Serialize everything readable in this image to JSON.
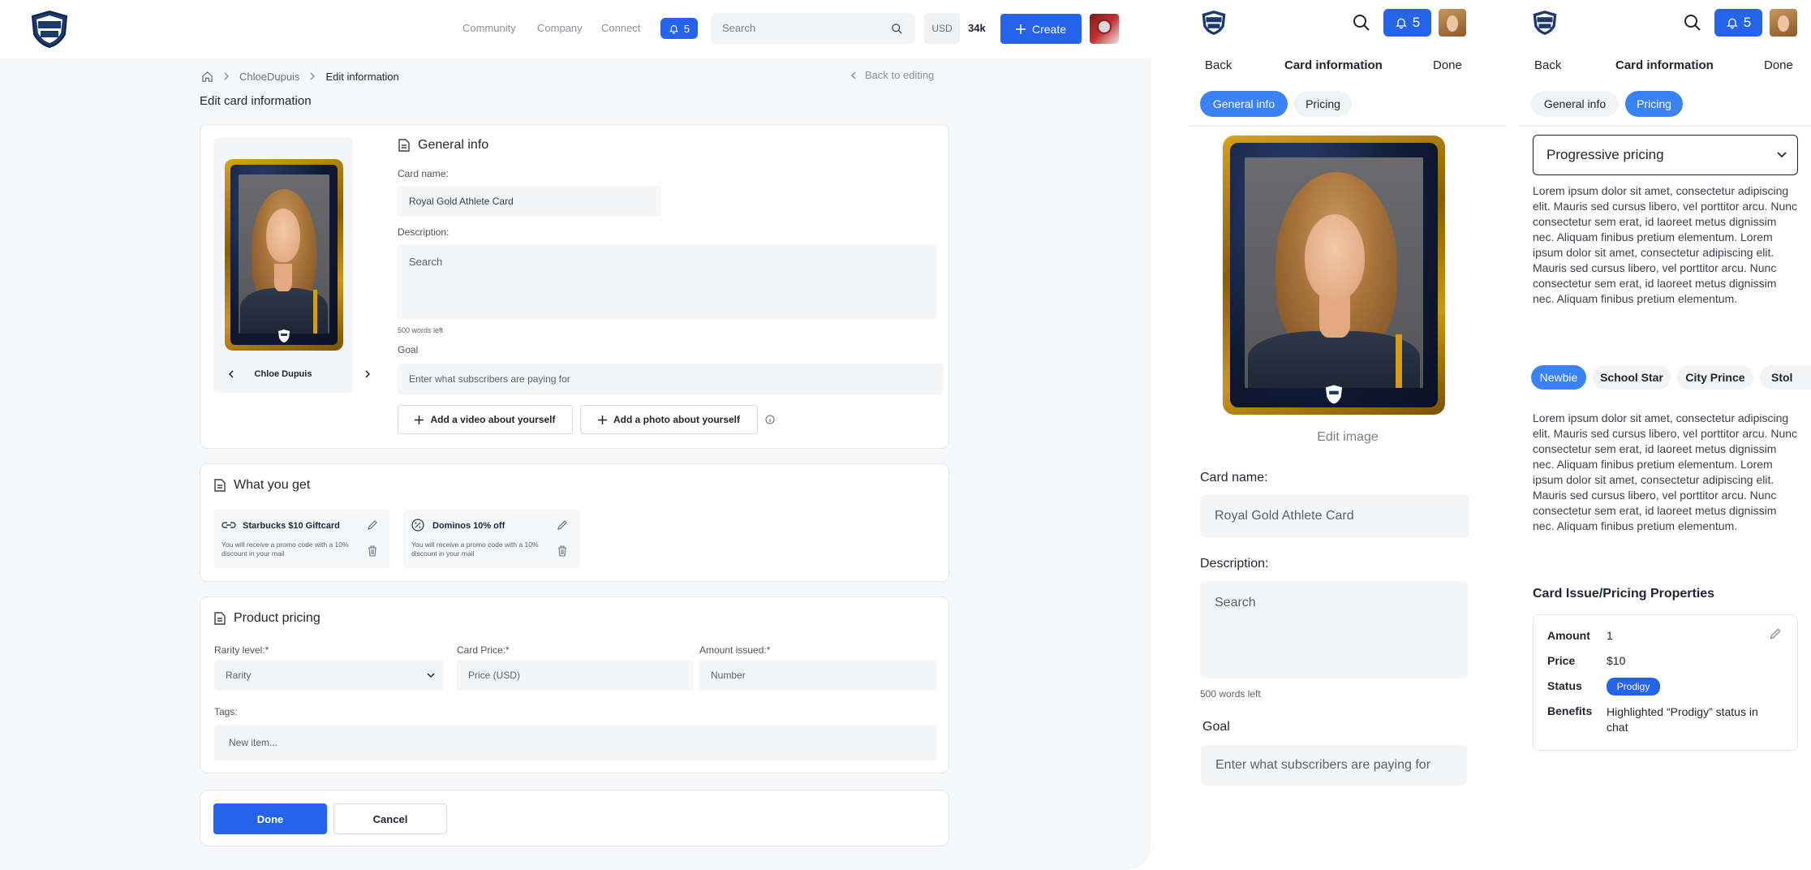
{
  "desktop": {
    "nav": {
      "links": [
        "Community",
        "Company",
        "Connect"
      ],
      "notif_count": "5",
      "search_placeholder": "Search",
      "currency": "USD",
      "balance": "34k",
      "create_label": "Create"
    },
    "breadcrumb": {
      "user": "ChloeDupuis",
      "current": "Edit information"
    },
    "back_to_editing": "Back to editing",
    "page_title": "Edit card information",
    "card_preview": {
      "name": "Chloe Dupuis"
    },
    "general_info": {
      "title": "General info",
      "card_name_label": "Card name:",
      "card_name_value": "Royal Gold Athlete Card",
      "description_label": "Description:",
      "description_placeholder": "Search",
      "words_left": "500 words left",
      "goal_label": "Goal",
      "goal_placeholder": "Enter what subscribers are paying for",
      "add_video": "Add a video about yourself",
      "add_photo": "Add a photo about yourself"
    },
    "what_you_get": {
      "title": "What you get",
      "perks": [
        {
          "title": "Starbucks $10 Giftcard",
          "desc": "You will receive a promo code with a 10% discount in your mail"
        },
        {
          "title": "Dominos 10% off",
          "desc": "You will receive a promo code with a 10% discount in your mail"
        }
      ]
    },
    "pricing": {
      "title": "Product pricing",
      "rarity_label": "Rarity level:*",
      "rarity_value": "Rarity",
      "price_label": "Card Price:*",
      "price_placeholder": "Price (USD)",
      "amount_label": "Amount issued:*",
      "amount_placeholder": "Number",
      "tags_label": "Tags:",
      "tags_placeholder": "New item..."
    },
    "actions": {
      "done": "Done",
      "cancel": "Cancel"
    }
  },
  "mobile_general": {
    "notif_count": "5",
    "back": "Back",
    "title": "Card information",
    "done": "Done",
    "tabs": [
      "General info",
      "Pricing"
    ],
    "edit_image": "Edit image",
    "card_name_label": "Card name:",
    "card_name_value": "Royal Gold Athlete Card",
    "description_label": "Description:",
    "description_placeholder": "Search",
    "words_left": "500 words left",
    "goal_label": "Goal",
    "goal_placeholder": "Enter what subscribers are paying for"
  },
  "mobile_pricing": {
    "notif_count": "5",
    "back": "Back",
    "title": "Card information",
    "done": "Done",
    "tabs": [
      "General info",
      "Pricing"
    ],
    "pricing_mode": "Progressive pricing",
    "intro_text": "Lorem ipsum dolor sit amet, consectetur adipiscing elit. Mauris sed cursus libero, vel porttitor arcu. Nunc consectetur sem erat, id laoreet metus dignissim nec. Aliquam finibus pretium elementum. Lorem ipsum dolor sit amet, consectetur adipiscing elit. Mauris sed cursus libero, vel porttitor arcu. Nunc consectetur sem erat, id laoreet metus dignissim nec. Aliquam finibus pretium elementum.",
    "tiers": [
      "Newbie",
      "School Star",
      "City Prince",
      "Stol"
    ],
    "tier_text": "Lorem ipsum dolor sit amet, consectetur adipiscing elit. Mauris sed cursus libero, vel porttitor arcu. Nunc consectetur sem erat, id laoreet metus dignissim nec. Aliquam finibus pretium elementum. Lorem ipsum dolor sit amet, consectetur adipiscing elit. Mauris sed cursus libero, vel porttitor arcu. Nunc consectetur sem erat, id laoreet metus dignissim nec. Aliquam finibus pretium elementum.",
    "props_title": "Card Issue/Pricing Properties",
    "props": {
      "amount_label": "Amount",
      "amount_value": "1",
      "price_label": "Price",
      "price_value": "$10",
      "status_label": "Status",
      "status_value": "Prodigy",
      "benefits_label": "Benefits",
      "benefits_value": "Highlighted “Prodigy” status in chat"
    }
  },
  "colors": {
    "accent": "#2563eb",
    "tab_active": "#3b82f6",
    "gold": "#d4a21a",
    "navy": "#0e1a33"
  }
}
